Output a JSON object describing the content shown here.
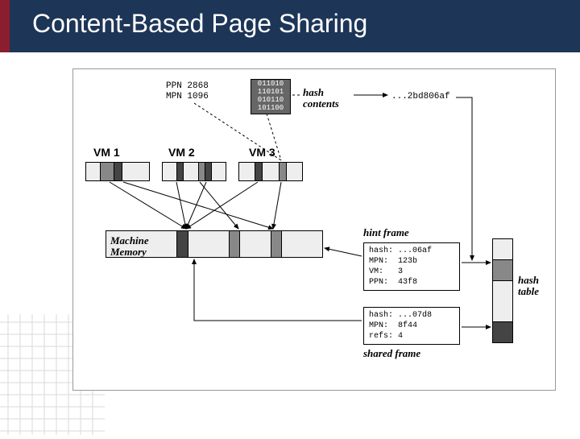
{
  "title": "Content-Based Page Sharing",
  "ppn_label": "PPN",
  "ppn_val": "2868",
  "mpn_label": "MPN",
  "mpn_val": "1096",
  "bits": [
    "011010",
    "110101",
    "010110",
    "101100"
  ],
  "hash_contents": "hash\ncontents",
  "hash_value": "...2bd806af",
  "vm1": "VM 1",
  "vm2": "VM 2",
  "vm3": "VM 3",
  "machine_memory": "Machine\nMemory",
  "hint_frame_label": "hint frame",
  "shared_frame_label": "shared frame",
  "hash_table_label": "hash\ntable",
  "hint_frame": {
    "hash": "...06af",
    "mpn": "123b",
    "vm": "3",
    "ppn": "43f8"
  },
  "shared_frame": {
    "hash": "...07d8",
    "mpn": "8f44",
    "refs": "4"
  }
}
